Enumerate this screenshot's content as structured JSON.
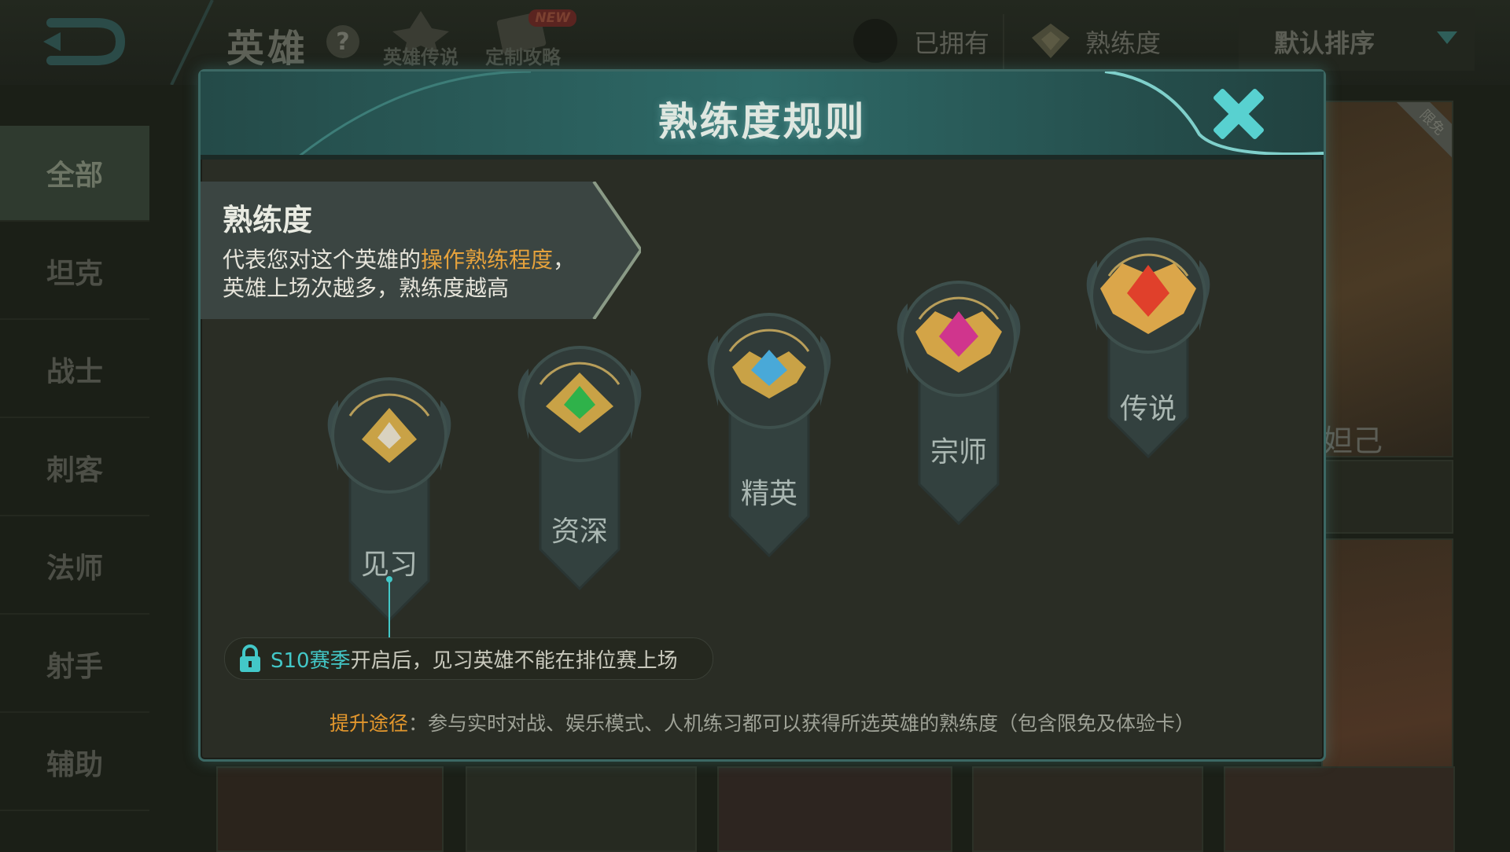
{
  "header": {
    "title": "英雄",
    "help": "?",
    "tabs": [
      {
        "label": "英雄传说",
        "badge": ""
      },
      {
        "label": "定制攻略",
        "badge": "NEW"
      }
    ],
    "owned_filter": "已拥有",
    "proficiency_filter": "熟练度",
    "sort": "默认排序"
  },
  "sidebar": {
    "items": [
      {
        "label": "全部",
        "active": true
      },
      {
        "label": "坦克"
      },
      {
        "label": "战士"
      },
      {
        "label": "刺客"
      },
      {
        "label": "法师"
      },
      {
        "label": "射手"
      },
      {
        "label": "辅助"
      }
    ]
  },
  "background_cards": {
    "free_tag": "限免",
    "partial_hero_name": "妲己"
  },
  "modal": {
    "title": "熟练度规则",
    "info": {
      "heading": "熟练度",
      "line1_prefix": "代表您对这个英雄的",
      "line1_highlight": "操作熟练程度",
      "line1_suffix": "，",
      "line2": "英雄上场次越多，熟练度越高"
    },
    "tiers": [
      {
        "label": "见习",
        "gem_color": "#d9d2c0"
      },
      {
        "label": "资深",
        "gem_color": "#2fb24a"
      },
      {
        "label": "精英",
        "gem_color": "#49a9d8"
      },
      {
        "label": "宗师",
        "gem_color": "#d0358d"
      },
      {
        "label": "传说",
        "gem_color": "#e0402b"
      }
    ],
    "locked_note": {
      "season": "S10赛季",
      "text": "开启后，见习英雄不能在排位赛上场"
    },
    "bottom_note": {
      "label": "提升途径",
      "colon": "：",
      "text": "参与实时对战、娱乐模式、人机练习都可以获得所选英雄的熟练度（包含限免及体验卡）"
    }
  },
  "colors": {
    "accent_cyan": "#43c8c8",
    "accent_orange": "#e6a23c",
    "gold": "#d8a94a"
  }
}
